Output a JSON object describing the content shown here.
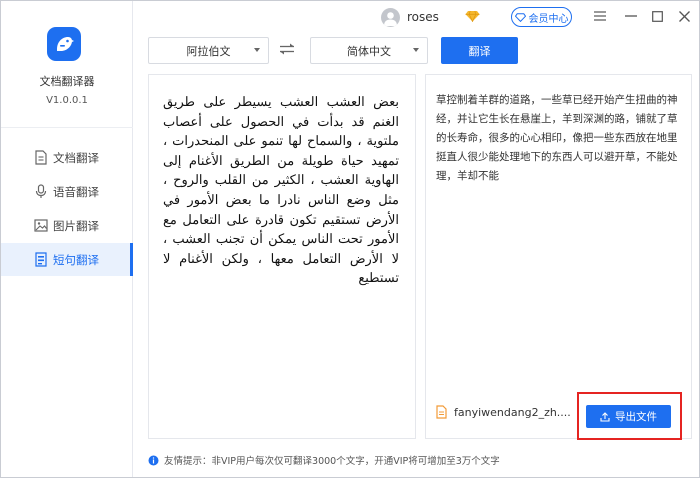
{
  "app": {
    "name": "文档翻译器",
    "version": "V1.0.0.1",
    "logo_icon": "bird-logo-icon",
    "accent_color": "#1e6ff0"
  },
  "titlebar": {
    "username": "roses",
    "vip_label": "会员中心",
    "controls": [
      "menu-icon",
      "minimize-icon",
      "maximize-icon",
      "close-icon"
    ]
  },
  "sidebar": {
    "items": [
      {
        "label": "文档翻译",
        "icon": "document-icon",
        "active": false
      },
      {
        "label": "语音翻译",
        "icon": "microphone-icon",
        "active": false
      },
      {
        "label": "图片翻译",
        "icon": "image-icon",
        "active": false
      },
      {
        "label": "短句翻译",
        "icon": "short-text-icon",
        "active": true
      }
    ]
  },
  "toolbar": {
    "source_lang": "阿拉伯文",
    "target_lang": "简体中文",
    "translate_label": "翻译"
  },
  "source": {
    "text": "بعض العشب العشب يسيطر على طريق الغنم قد بدأت في الحصول على أعصاب ملتوية ، والسماح لها تنمو على المنحدرات ، تمهيد حياة طويلة من الطريق الأغنام إلى الهاوية العشب ، الكثير من القلب والروح ، مثل وضع الناس نادرا ما بعض الأمور في الأرض تستقيم تكون قادرة على التعامل مع الأمور تحت الناس يمكن أن تجنب العشب ، لا الأرض التعامل معها ، ولكن الأغنام لا تستطيع"
  },
  "result": {
    "text": "草控制着羊群的道路，一些草已经开始产生扭曲的神经，并让它生长在悬崖上，羊到深渊的路，铺就了草的长寿命，很多的心心相印，像把一些东西放在地里挺直人很少能处理地下的东西人可以避开草，不能处理，羊却不能",
    "file_name": "fanyiwendang2_zh....",
    "export_label": "导出文件"
  },
  "footer": {
    "tip": "友情提示：非VIP用户每次仅可翻译3000个文字，开通VIP将可增加至3万个文字"
  }
}
